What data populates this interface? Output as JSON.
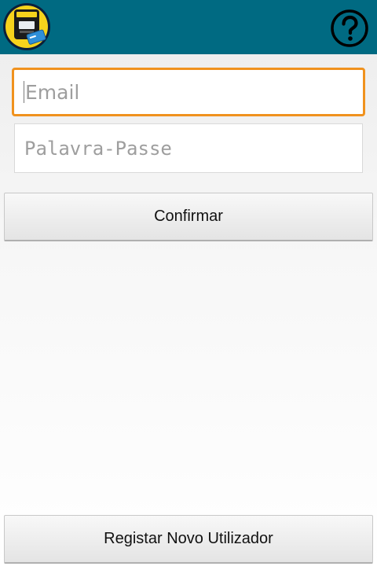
{
  "header": {
    "logo_icon": "ticket-machine-logo-icon",
    "help_icon": "question-circle-icon",
    "background_color": "#006a82"
  },
  "login_form": {
    "email_placeholder": "Email",
    "password_placeholder": "Palavra-Passe",
    "confirm_label": "Confirmar",
    "focus_color": "#f0921e"
  },
  "footer": {
    "register_label": "Registar Novo Utilizador"
  }
}
